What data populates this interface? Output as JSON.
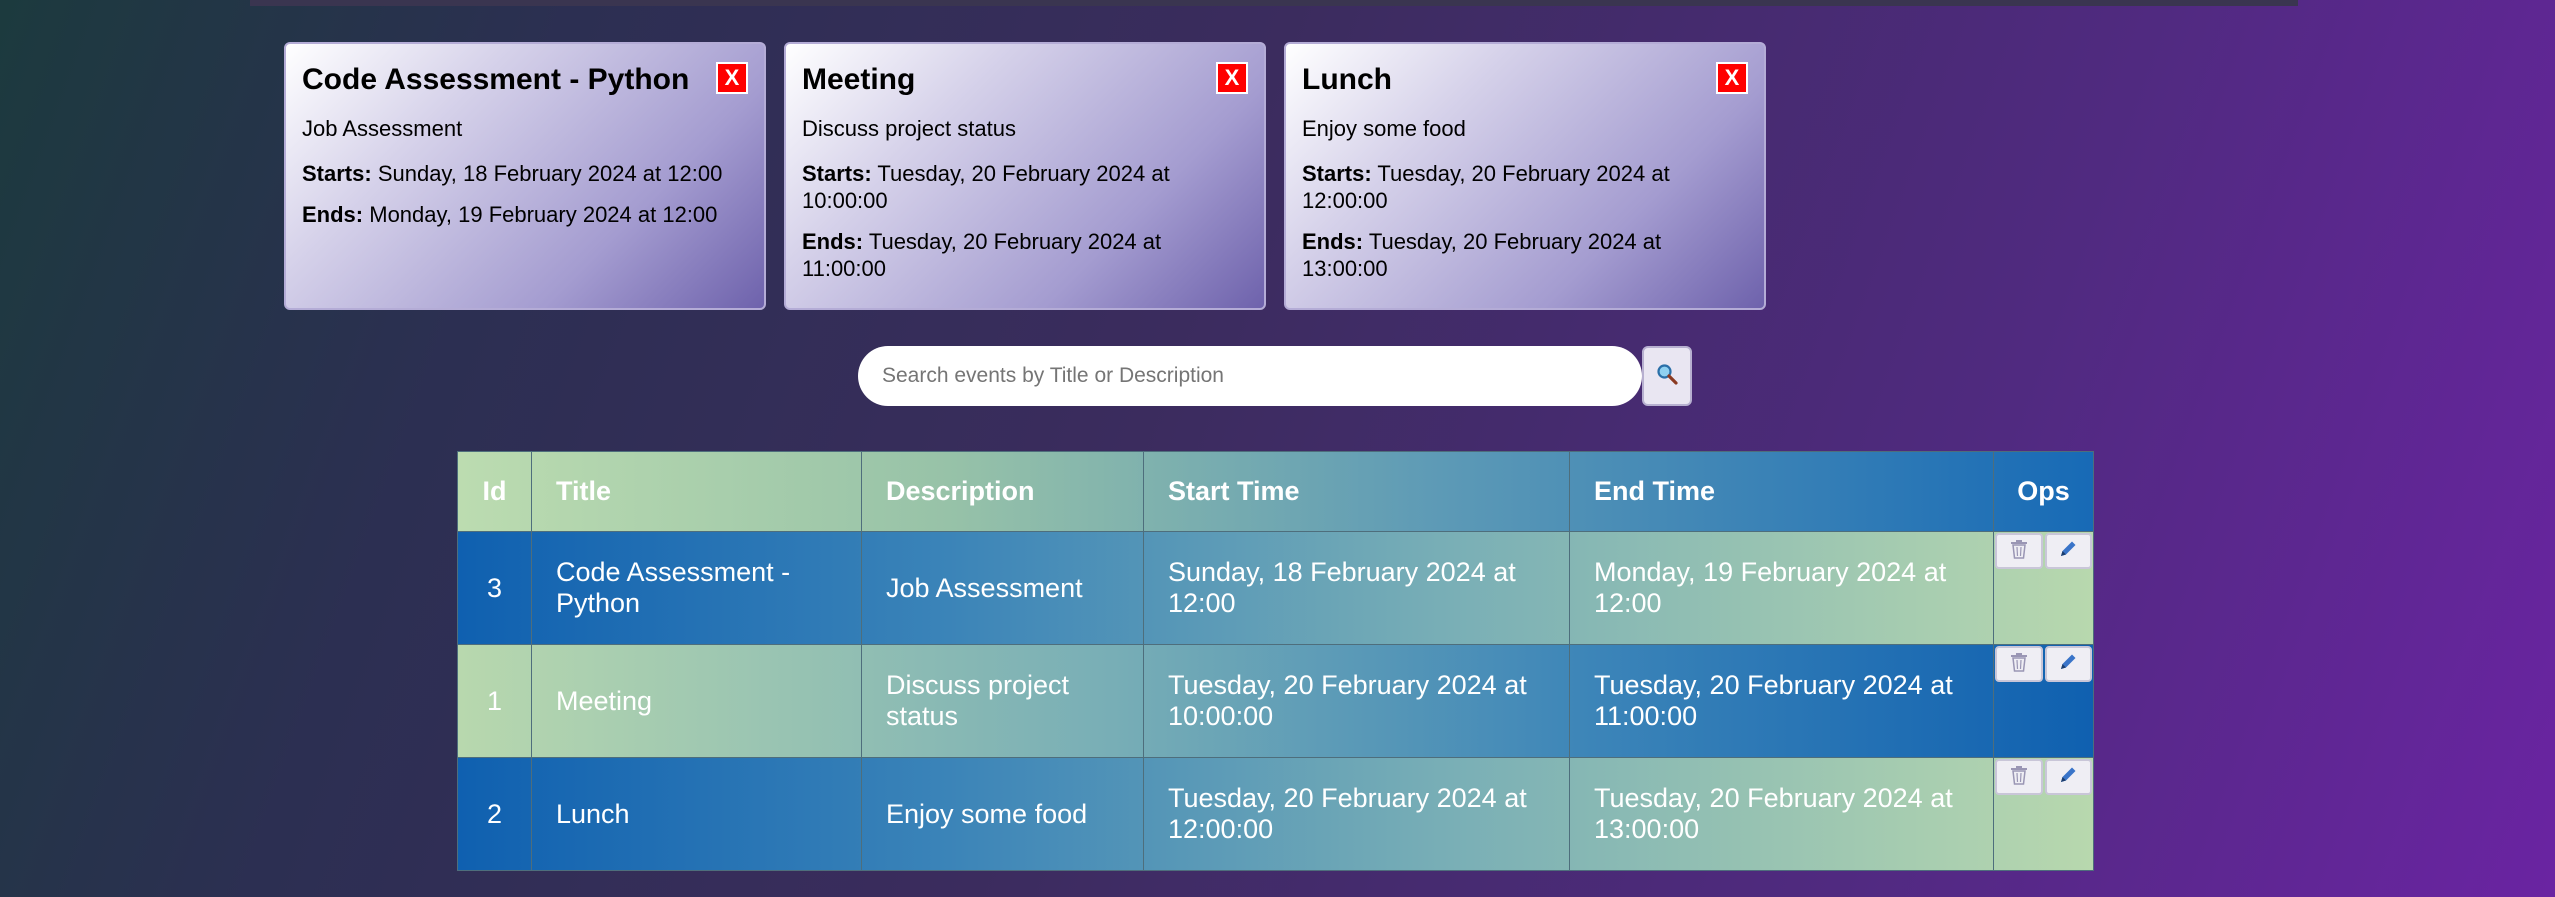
{
  "cards": [
    {
      "title": "Code Assessment - Python",
      "close": "X",
      "description": "Job Assessment",
      "starts_label": "Starts:",
      "starts": "Sunday, 18 February 2024 at 12:00",
      "ends_label": "Ends:",
      "ends": "Monday, 19 February 2024 at 12:00"
    },
    {
      "title": "Meeting",
      "close": "X",
      "description": "Discuss project status",
      "starts_label": "Starts:",
      "starts": "Tuesday, 20 February 2024 at 10:00:00",
      "ends_label": "Ends:",
      "ends": "Tuesday, 20 February 2024 at 11:00:00"
    },
    {
      "title": "Lunch",
      "close": "X",
      "description": "Enjoy some food",
      "starts_label": "Starts:",
      "starts": "Tuesday, 20 February 2024 at 12:00:00",
      "ends_label": "Ends:",
      "ends": "Tuesday, 20 February 2024 at 13:00:00"
    }
  ],
  "search": {
    "placeholder": "Search events by Title or Description",
    "value": "",
    "button_icon": "magnifier-icon"
  },
  "table": {
    "headers": [
      "Id",
      "Title",
      "Description",
      "Start Time",
      "End Time",
      "Ops"
    ],
    "rows": [
      {
        "id": "3",
        "title": "Code Assessment - Python",
        "description": "Job Assessment",
        "start": "Sunday, 18 February 2024 at 12:00",
        "end": "Monday, 19 February 2024 at 12:00"
      },
      {
        "id": "1",
        "title": "Meeting",
        "description": "Discuss project status",
        "start": "Tuesday, 20 February 2024 at 10:00:00",
        "end": "Tuesday, 20 February 2024 at 11:00:00"
      },
      {
        "id": "2",
        "title": "Lunch",
        "description": "Enjoy some food",
        "start": "Tuesday, 20 February 2024 at 12:00:00",
        "end": "Tuesday, 20 February 2024 at 13:00:00"
      }
    ],
    "ops_icons": [
      "trash-icon",
      "pencil-icon"
    ]
  },
  "colors": {
    "close_button": "#ff0000",
    "header_start": "#bcdcb0",
    "header_end": "#176ab6"
  }
}
